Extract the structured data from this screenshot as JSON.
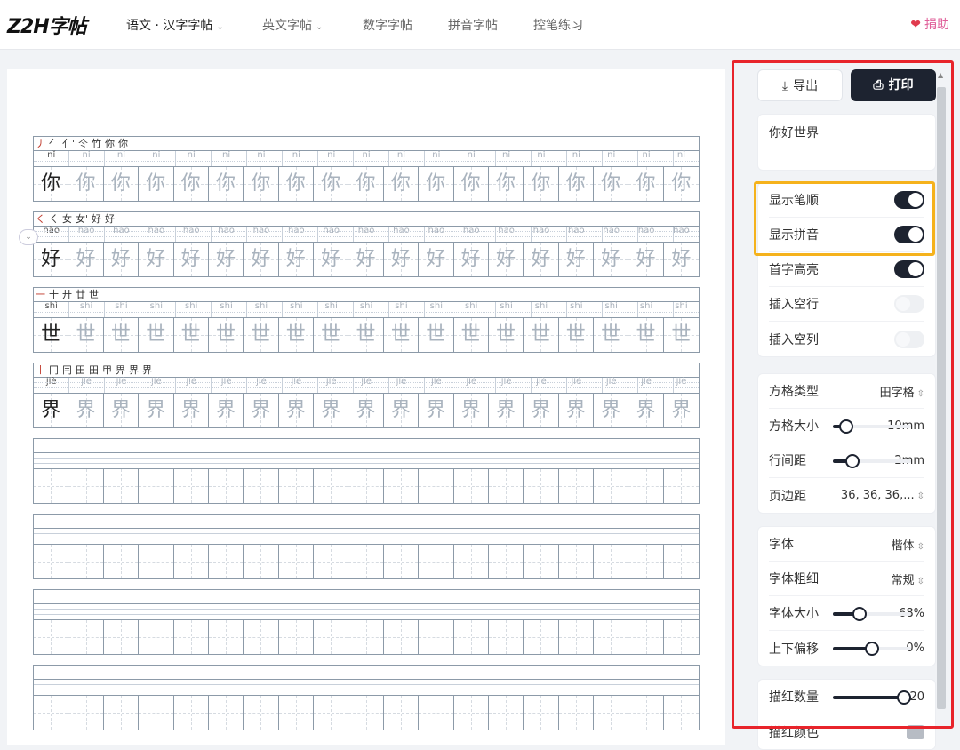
{
  "header": {
    "logo": "Z2H字帖",
    "nav": [
      {
        "label": "语文 · 汉字字帖",
        "dropdown": true,
        "active": true
      },
      {
        "label": "英文字帖",
        "dropdown": true
      },
      {
        "label": "数字字帖"
      },
      {
        "label": "拼音字帖"
      },
      {
        "label": "控笔练习"
      }
    ],
    "donate": "捐助"
  },
  "worksheet": {
    "rows": [
      {
        "char": "你",
        "pinyin": "nǐ",
        "strokes": [
          "丿",
          "亻",
          "亻'",
          "仒",
          "竹",
          "你",
          "你"
        ]
      },
      {
        "char": "好",
        "pinyin": "hǎo",
        "strokes": [
          "く",
          "ㄑ",
          "女",
          "女'",
          "好",
          "好"
        ]
      },
      {
        "char": "世",
        "pinyin": "shì",
        "strokes": [
          "一",
          "十",
          "廾",
          "廿",
          "世"
        ]
      },
      {
        "char": "界",
        "pinyin": "jiè",
        "strokes": [
          "丨",
          "冂",
          "冃",
          "田",
          "田",
          "甲",
          "畀",
          "界",
          "界"
        ]
      }
    ],
    "cells_per_row": 19,
    "empty_blocks": 4
  },
  "panel": {
    "export_label": "导出",
    "print_label": "打印",
    "text_input": "你好世界",
    "toggles": [
      {
        "label": "显示笔顺",
        "on": true
      },
      {
        "label": "显示拼音",
        "on": true
      },
      {
        "label": "首字高亮",
        "on": true
      },
      {
        "label": "插入空行",
        "on": false
      },
      {
        "label": "插入空列",
        "on": false
      }
    ],
    "grid": {
      "type_label": "方格类型",
      "type_value": "田字格",
      "size_label": "方格大小",
      "size_value": "10mm",
      "size_level": 0.1,
      "spacing_label": "行间距",
      "spacing_value": "2mm",
      "spacing_level": 0.2,
      "margin_label": "页边距",
      "margin_value": "36, 36, 36,..."
    },
    "font": {
      "family_label": "字体",
      "family_value": "楷体",
      "weight_label": "字体粗细",
      "weight_value": "常规",
      "size_label": "字体大小",
      "size_value": "68%",
      "size_level": 0.3,
      "offset_label": "上下偏移",
      "offset_value": "0%",
      "offset_level": 0.5
    },
    "trace": {
      "count_label": "描红数量",
      "count_value": "20",
      "count_level": 1.0,
      "color_label": "描红颜色"
    }
  },
  "colors": {
    "accent": "#1d2330",
    "red_highlight": "#e8242b",
    "yellow_highlight": "#f5b21c",
    "donate": "#e0609a"
  }
}
